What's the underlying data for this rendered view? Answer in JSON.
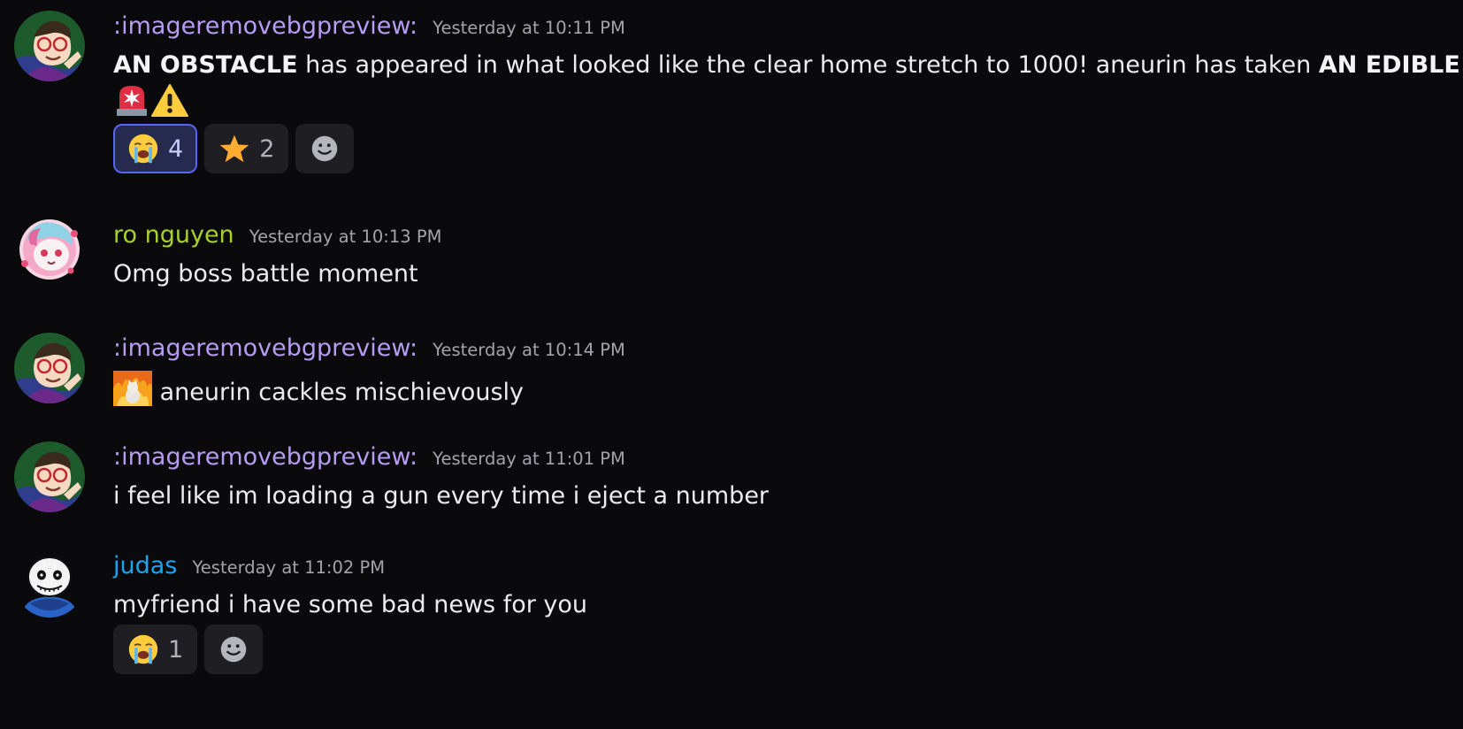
{
  "messages": [
    {
      "author": ":imageremovebgpreview:",
      "author_color": "#b69cf2",
      "time": "Yesterday at 10:11 PM",
      "text_bold_1": "AN OBSTACLE",
      "text_1": " has appeared in what looked like the clear home stretch to 1000! aneurin has taken ",
      "text_bold_2": "AN EDIBLE",
      "emojis": [
        "rotating-light-icon",
        "warning-icon"
      ],
      "reactions": [
        {
          "icon": "loudly-crying-face-icon",
          "count": "4",
          "active": true
        },
        {
          "icon": "star-icon",
          "count": "2",
          "active": false
        }
      ]
    },
    {
      "author": "ro nguyen",
      "author_color": "#a7d02f",
      "time": "Yesterday at 10:13 PM",
      "text": "Omg boss battle moment"
    },
    {
      "author": ":imageremovebgpreview:",
      "author_color": "#b69cf2",
      "time": "Yesterday at 10:14 PM",
      "text": " aneurin cackles mischievously",
      "emoji": "fire-cat-icon"
    },
    {
      "author": ":imageremovebgpreview:",
      "author_color": "#b69cf2",
      "time": "Yesterday at 11:01 PM",
      "text": "i feel like im loading a gun every time i eject a number"
    },
    {
      "author": "judas",
      "author_color": "#19a4ef",
      "time": "Yesterday at 11:02 PM",
      "text": "myfriend i have some bad news for you",
      "reactions": [
        {
          "icon": "loudly-crying-face-icon",
          "count": "1",
          "active": false
        }
      ]
    }
  ],
  "add_reaction_icon": "add-reaction-icon"
}
